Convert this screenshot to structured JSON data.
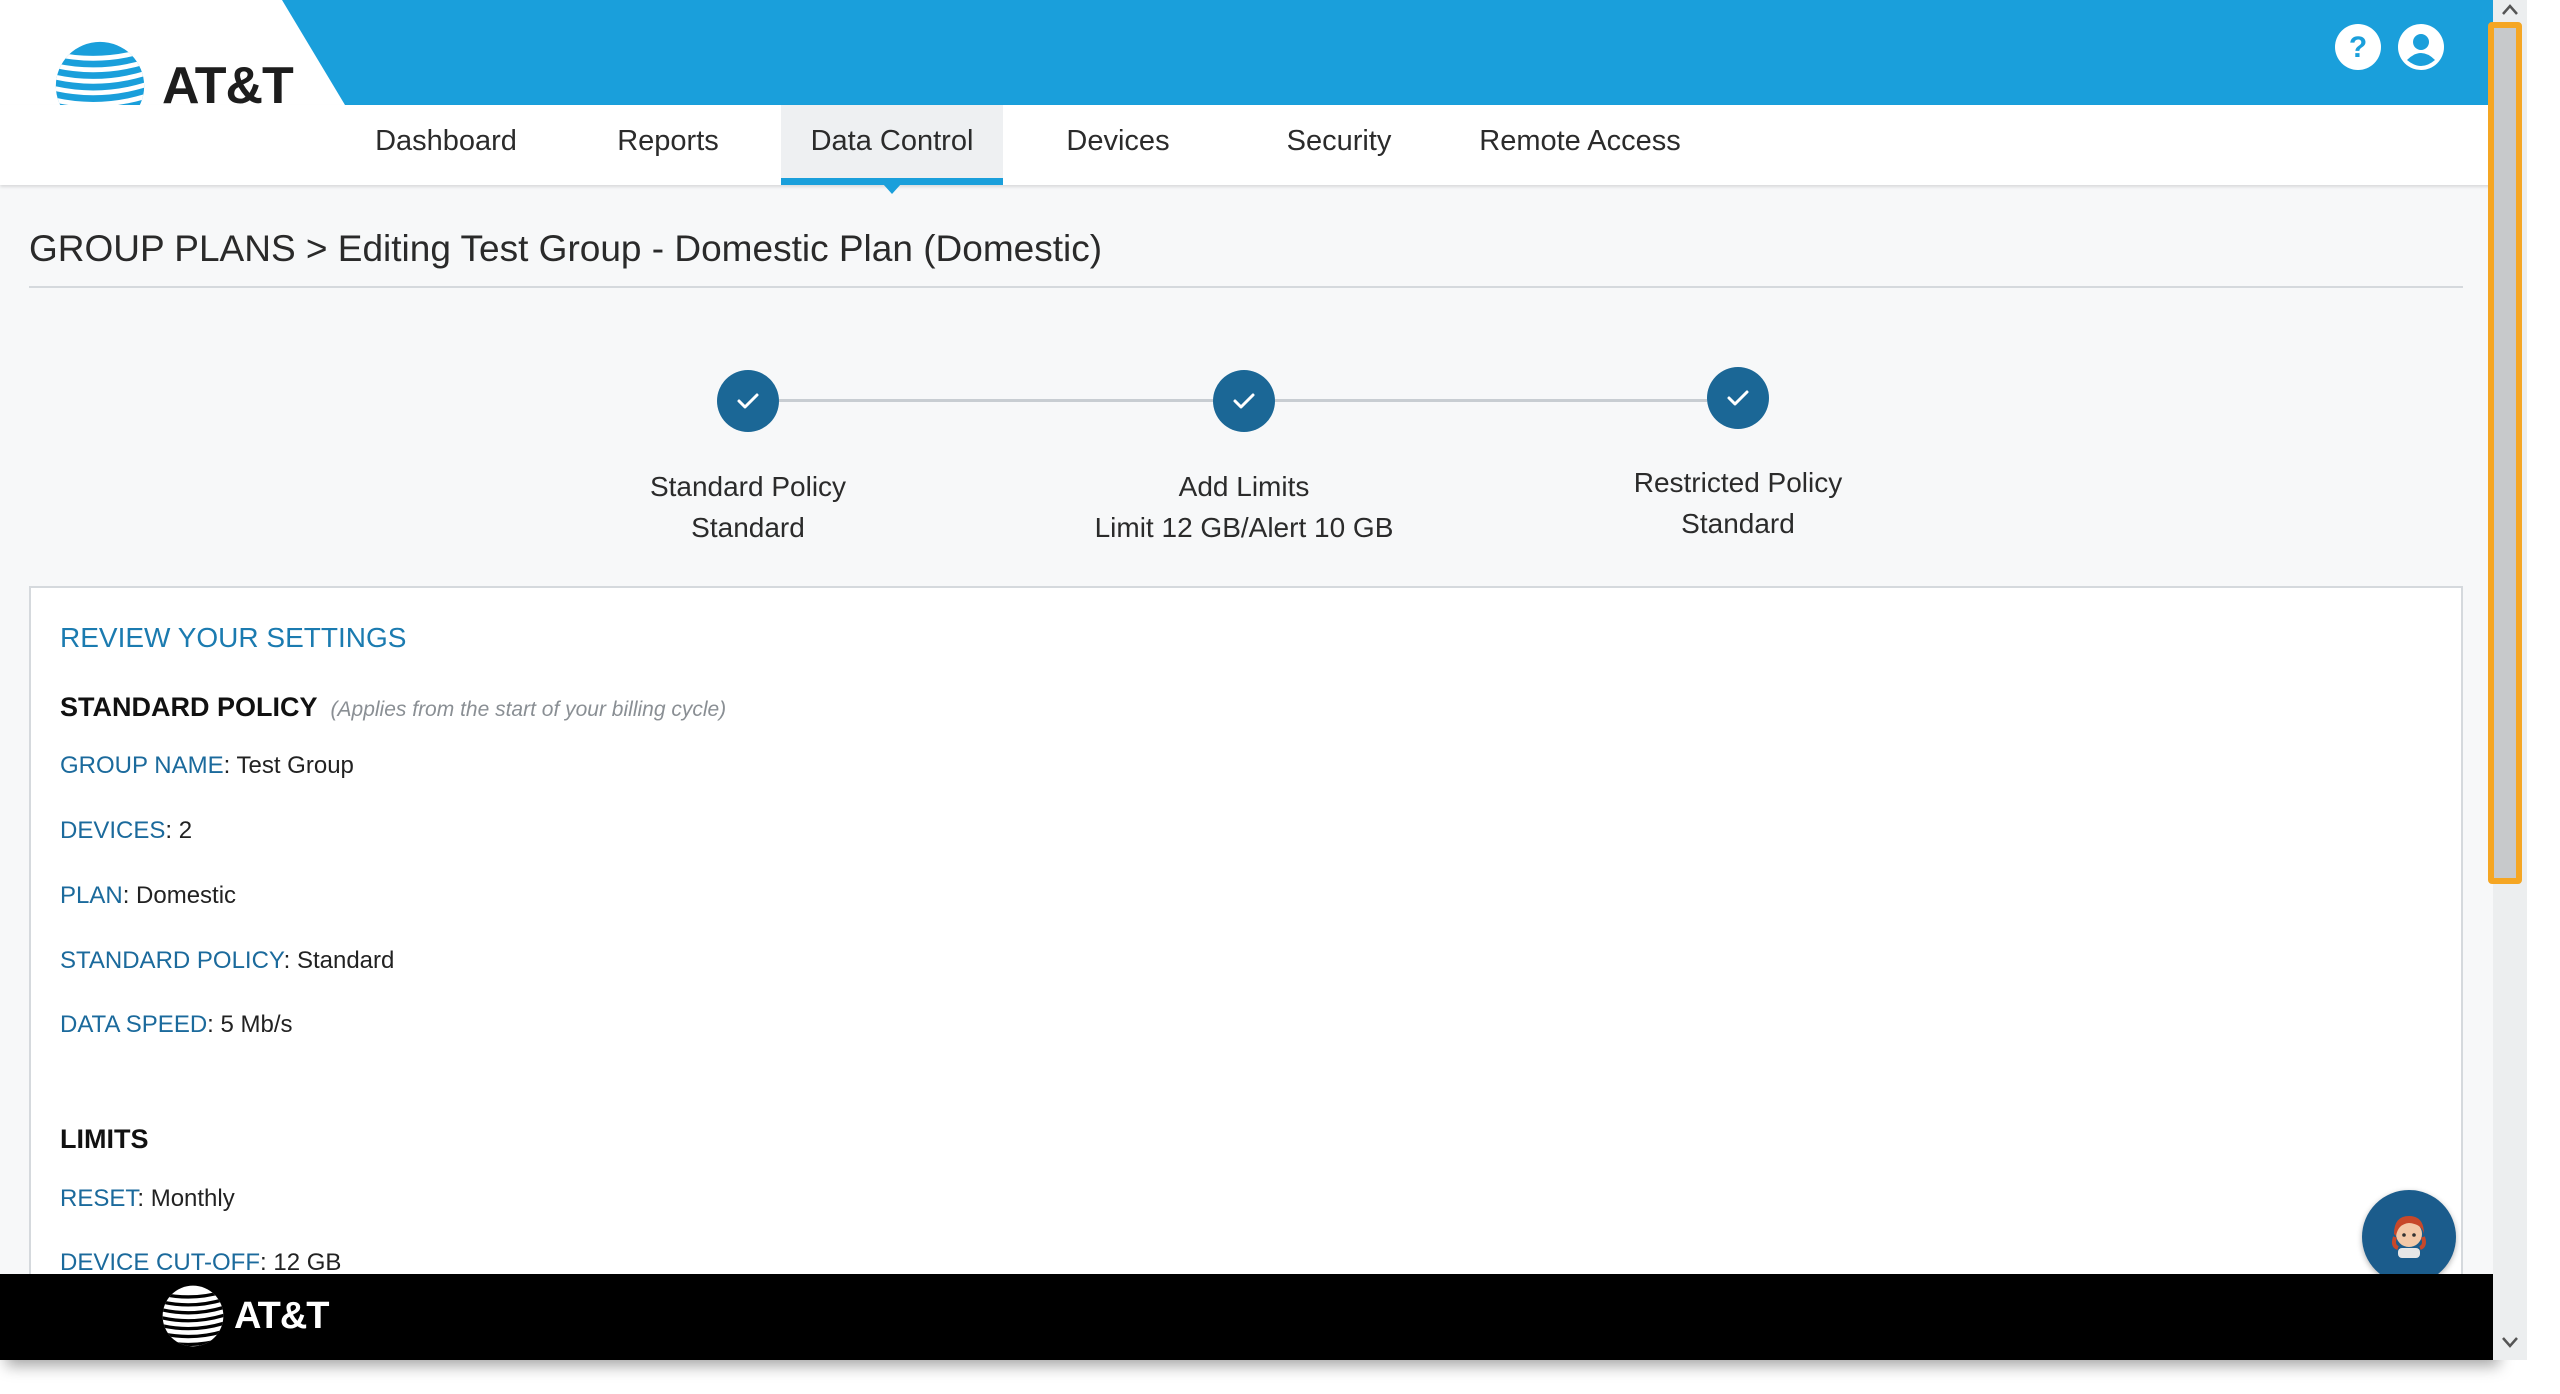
{
  "brand": {
    "name": "AT&T",
    "primary_color": "#1a9fdb",
    "step_color": "#1b6796"
  },
  "nav": {
    "items": [
      {
        "label": "Dashboard"
      },
      {
        "label": "Reports"
      },
      {
        "label": "Data Control",
        "active": true
      },
      {
        "label": "Devices"
      },
      {
        "label": "Security"
      },
      {
        "label": "Remote Access"
      }
    ]
  },
  "header_icons": [
    "help-icon",
    "user-account-icon"
  ],
  "page": {
    "title": "GROUP PLANS > Editing Test Group - Domestic Plan (Domestic)"
  },
  "steps": [
    {
      "title": "Standard Policy",
      "subtitle": "Standard",
      "completed": true
    },
    {
      "title": "Add Limits",
      "subtitle": "Limit 12 GB/Alert 10 GB",
      "completed": true
    },
    {
      "title": "Restricted Policy",
      "subtitle": "Standard",
      "completed": true
    }
  ],
  "review": {
    "heading": "REVIEW YOUR SETTINGS",
    "standard_policy": {
      "title": "STANDARD POLICY",
      "note": "(Applies from the start of your billing cycle)",
      "rows": [
        {
          "label": "GROUP NAME",
          "value": ": Test Group"
        },
        {
          "label": "DEVICES",
          "value": ": 2"
        },
        {
          "label": "PLAN",
          "value": ": Domestic"
        },
        {
          "label": "STANDARD POLICY",
          "value": ": Standard"
        },
        {
          "label": "DATA SPEED",
          "value": ": 5 Mb/s"
        }
      ]
    },
    "limits": {
      "title": "LIMITS",
      "rows": [
        {
          "label": "RESET",
          "value": ": Monthly"
        },
        {
          "label": "DEVICE CUT-OFF",
          "value": ": 12 GB"
        }
      ]
    }
  },
  "footer": {
    "logo_text": "AT&T"
  },
  "chat_icon": "chat-assistant-icon"
}
